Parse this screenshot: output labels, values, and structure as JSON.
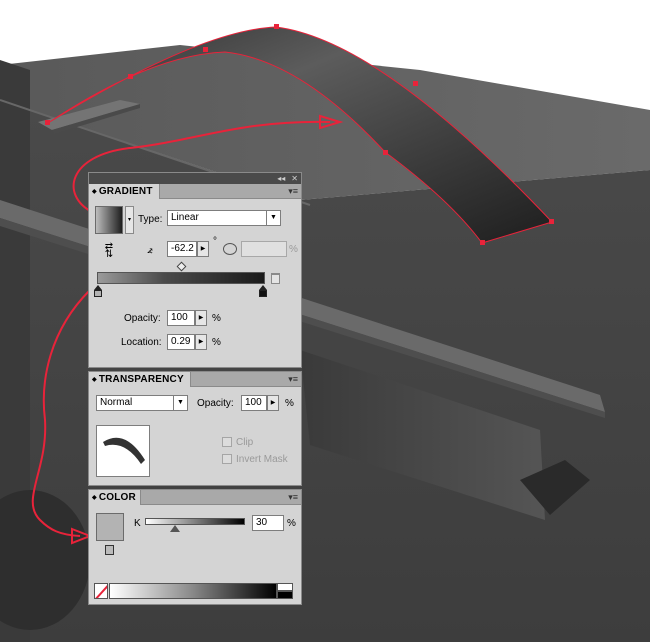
{
  "gradient_panel": {
    "title": "GRADIENT",
    "type_label": "Type:",
    "type_value": "Linear",
    "angle_value": "-62.2",
    "aspect_unit": "%",
    "degree_symbol": "°",
    "opacity_label": "Opacity:",
    "opacity_value": "100",
    "opacity_unit": "%",
    "location_label": "Location:",
    "location_value": "0.29",
    "location_unit": "%"
  },
  "transparency_panel": {
    "title": "TRANSPARENCY",
    "blend_mode": "Normal",
    "opacity_label": "Opacity:",
    "opacity_value": "100",
    "opacity_unit": "%",
    "clip_label": "Clip",
    "invert_mask_label": "Invert Mask"
  },
  "color_panel": {
    "title": "COLOR",
    "channel_label": "K",
    "channel_value": "30",
    "channel_unit": "%"
  },
  "panel_controls": {
    "collapse_glyph": "◂◂",
    "close_glyph": "✕",
    "menu_glyph": "▾≡"
  },
  "colors": {
    "annotation_red": "#e8233a",
    "panel_bg": "#d4d4d4",
    "swatch_fill": "#b3b3b3"
  }
}
